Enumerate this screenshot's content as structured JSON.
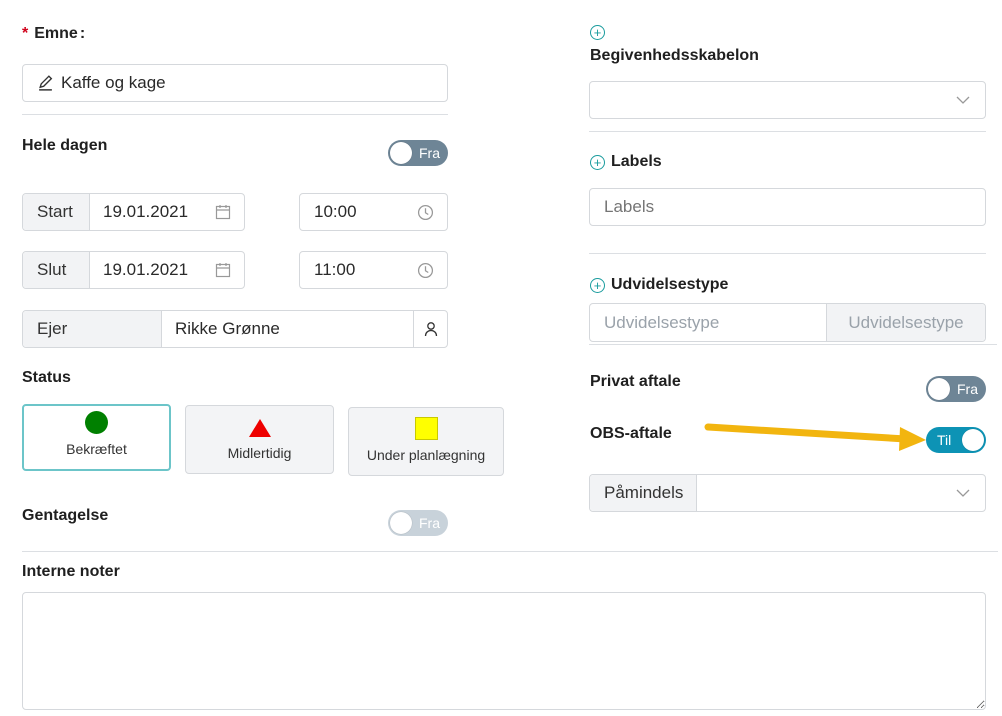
{
  "subject": {
    "required_mark": "*",
    "label": "Emne",
    "colon": ":",
    "value": "Kaffe og kage"
  },
  "all_day": {
    "label": "Hele dagen",
    "toggle_text": "Fra"
  },
  "start": {
    "label": "Start",
    "date": "19.01.2021",
    "time": "10:00"
  },
  "end": {
    "label": "Slut",
    "date": "19.01.2021",
    "time": "11:00"
  },
  "owner": {
    "label": "Ejer",
    "value": "Rikke Grønne"
  },
  "status": {
    "label": "Status",
    "options": [
      {
        "label": "Bekræftet",
        "color": "#008000",
        "shape": "circle"
      },
      {
        "label": "Midlertidig",
        "color": "#ee0000",
        "shape": "triangle"
      },
      {
        "label": "Under planlægning",
        "color": "#ffff00",
        "shape": "square"
      }
    ]
  },
  "recurrence": {
    "label": "Gentagelse",
    "toggle_text": "Fra"
  },
  "event_template": {
    "label": "Begivenhedsskabelon",
    "value": ""
  },
  "labels": {
    "label": "Labels",
    "placeholder": "Labels"
  },
  "extension_type": {
    "label": "Udvidelsestype",
    "placeholder": "Udvidelsestype",
    "button_text": "Udvidelsestype"
  },
  "private": {
    "label": "Privat aftale",
    "toggle_text": "Fra"
  },
  "obs": {
    "label": "OBS-aftale",
    "toggle_text": "Til"
  },
  "reminder": {
    "label": "Påmindels",
    "value": ""
  },
  "notes": {
    "label": "Interne noter",
    "value": ""
  },
  "colors": {
    "accent": "#0d93b5",
    "teal": "#1a9c9e",
    "arrow": "#f2b50f"
  }
}
